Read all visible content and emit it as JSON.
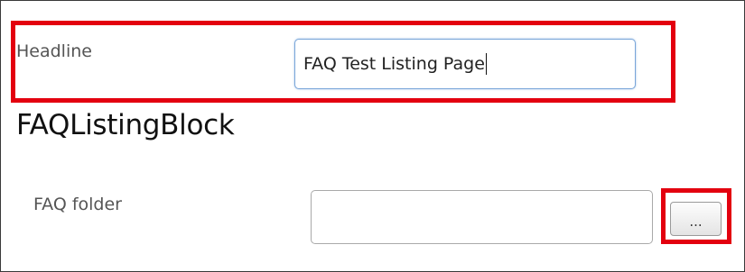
{
  "form": {
    "headline": {
      "label": "Headline",
      "value": "FAQ Test Listing Page"
    },
    "block_title": "FAQListingBlock",
    "faq_folder": {
      "label": "FAQ folder",
      "value": "",
      "browse_label": "..."
    }
  },
  "colors": {
    "highlight": "#e3000f",
    "focus_border": "#7aa6d9"
  }
}
